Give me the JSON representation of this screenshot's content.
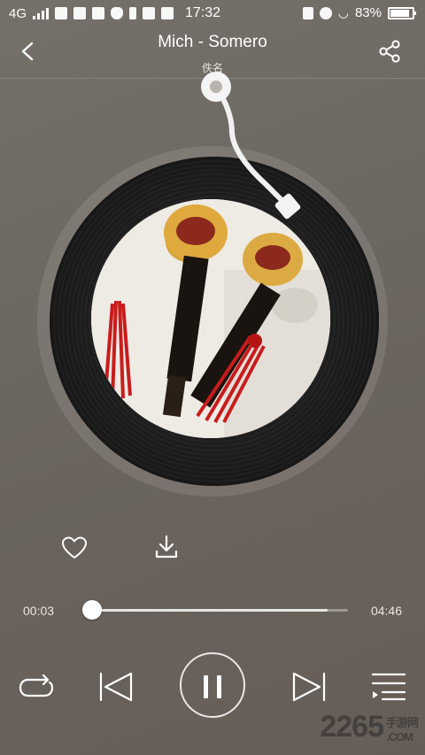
{
  "status_bar": {
    "network": "4G",
    "time": "17:32",
    "battery": "83%"
  },
  "header": {
    "title": "Mich - Somero",
    "artist": "佚名",
    "back_icon": "chevron-left-icon",
    "share_icon": "share-icon"
  },
  "player": {
    "elapsed": "00:03",
    "duration": "04:46",
    "progress": 0.011,
    "buffered": 0.92
  },
  "watermark": {
    "text": "2265",
    "suffix": "手游网",
    "domain": ".COM"
  }
}
